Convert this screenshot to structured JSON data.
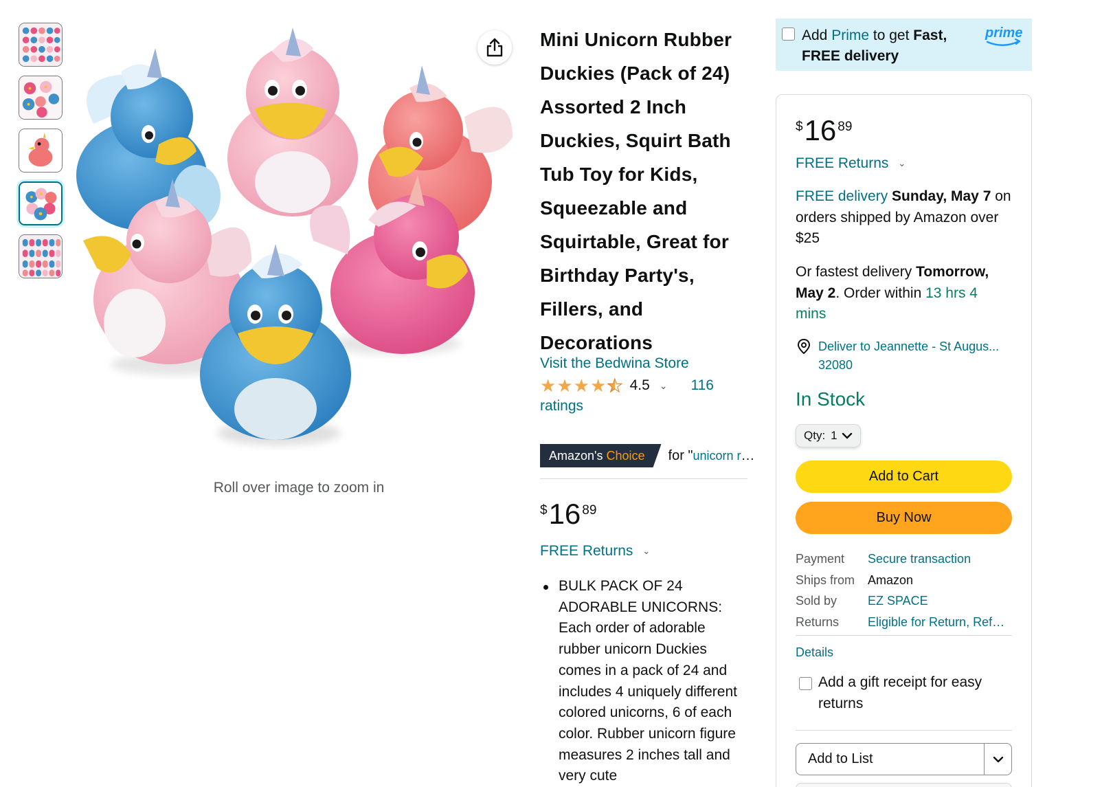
{
  "product": {
    "title": "Mini Unicorn Rubber Duckies (Pack of 24) Assorted 2 Inch Duckies, Squirt Bath Tub Toy for Kids, Squeezable and Squirtable, Great for Birthday Party's, Fillers, and Decorations",
    "store_link": "Visit the Bedwina Store",
    "rating_value": "4.5",
    "ratings_count": "116",
    "ratings_word": "ratings",
    "badge_prefix": "Amazon's",
    "badge_word": "Choice",
    "badge_for": "for \"",
    "badge_query": "unicorn rubber duckies\"",
    "price_symbol": "$",
    "price_whole": "16",
    "price_fraction": "89",
    "free_returns": "FREE Returns",
    "bullet_text": "BULK PACK OF 24 ADORABLE UNICORNS: Each order of adorable rubber unicorn Duckies comes in a pack of 24 and includes 4 uniquely different colored unicorns, 6 of each color. Rubber unicorn figure measures 2 inches tall and very cute"
  },
  "gallery": {
    "zoom_hint": "Roll over image to zoom in",
    "selected_index": 3,
    "thumbnail_count": 5
  },
  "prime": {
    "add": "Add ",
    "prime_word": "Prime",
    "to_get": " to get ",
    "fast": "Fast,",
    "free_delivery": "FREE delivery",
    "logo_text": "prime"
  },
  "buybox": {
    "price_symbol": "$",
    "price_whole": "16",
    "price_fraction": "89",
    "free_returns": "FREE Returns",
    "delivery_link": "FREE delivery",
    "delivery_date": "Sunday, May 7",
    "delivery_rest": " on orders shipped by Amazon over $25",
    "fastest_prefix": "Or fastest delivery ",
    "fastest_date": "Tomorrow, May 2",
    "order_within": ". Order within ",
    "countdown": "13 hrs 4 mins",
    "deliver_to": "Deliver to Jeannette - St Augus...",
    "zip": "32080",
    "stock": "In Stock",
    "qty_label": "Qty:",
    "qty_value": "1",
    "add_to_cart": "Add to Cart",
    "buy_now": "Buy Now",
    "payment_label": "Payment",
    "payment_value": "Secure transaction",
    "ships_from_label": "Ships from",
    "ships_from_value": "Amazon",
    "sold_by_label": "Sold by",
    "sold_by_value": "EZ SPACE",
    "returns_label": "Returns",
    "returns_value": "Eligible for Return, Refund or Replacement",
    "details": "Details",
    "gift_receipt": "Add a gift receipt for easy returns",
    "add_to_list": "Add to List"
  },
  "colors": {
    "link": "#007185",
    "green": "#067d62",
    "cart_yellow": "#ffd814",
    "buy_orange": "#ffa41c",
    "prime_bg": "#d9f1f9",
    "badge_bg": "#232f3e",
    "star": "#f3a847"
  }
}
